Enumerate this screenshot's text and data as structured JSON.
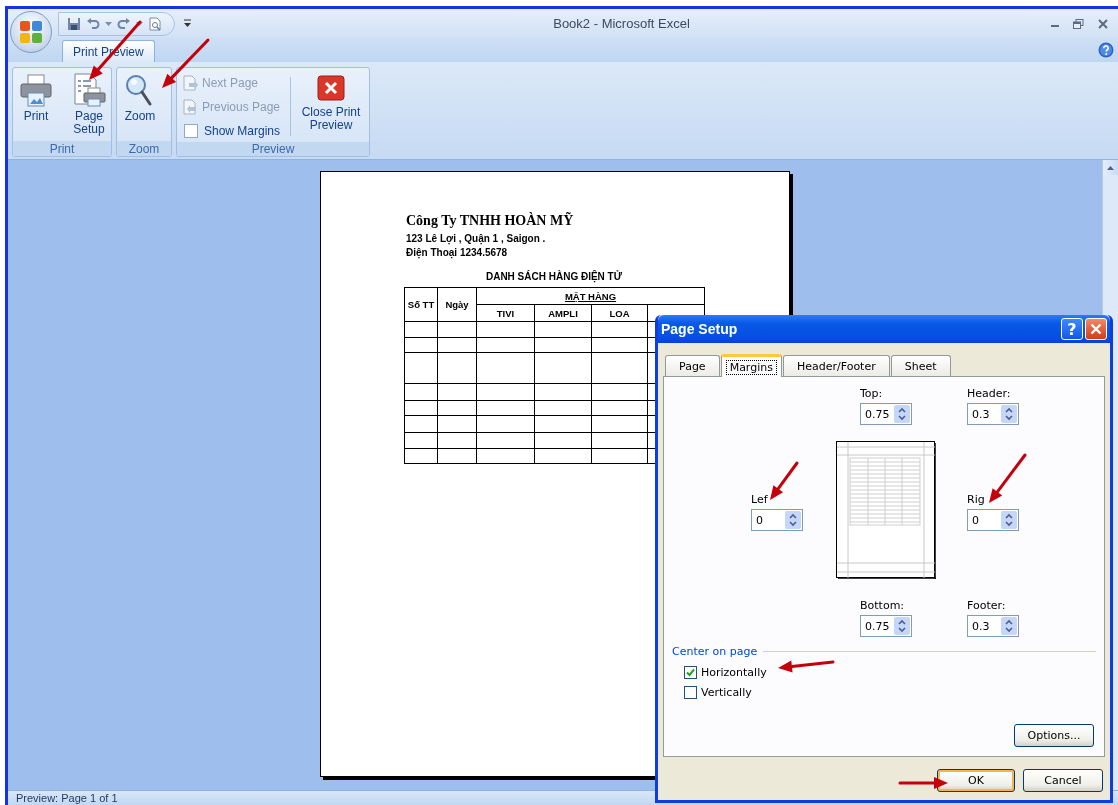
{
  "window": {
    "title": "Book2 - Microsoft Excel"
  },
  "ribbon": {
    "tabs": [
      {
        "label": "Print Preview",
        "selected": true
      }
    ],
    "groups": [
      {
        "label": "Print",
        "items": [
          {
            "kind": "large",
            "label": "Print"
          },
          {
            "kind": "large",
            "label": "Page Setup"
          }
        ]
      },
      {
        "label": "Zoom",
        "items": [
          {
            "kind": "large",
            "label": "Zoom"
          }
        ]
      },
      {
        "label": "Preview",
        "items": [
          {
            "kind": "small",
            "label": "Next Page",
            "disabled": true
          },
          {
            "kind": "small",
            "label": "Previous Page",
            "disabled": true
          },
          {
            "kind": "check",
            "label": "Show Margins",
            "checked": false
          },
          {
            "kind": "large",
            "label": "Close Print Preview"
          }
        ]
      }
    ]
  },
  "preview_page": {
    "company": "Công Ty TNHH HOÀN MỸ",
    "address": "123 Lê Lợi , Quận 1 , Saigon .",
    "phone": "Điện Thoại 1234.5678",
    "table_title": "DANH SÁCH HÀNG ĐIỆN TỬ",
    "columns": [
      "Số TT",
      "Ngày"
    ],
    "group_header": "MẶT HÀNG",
    "subcolumns": [
      "TIVI",
      "AMPLI",
      "LOA"
    ]
  },
  "status_bar": {
    "text": "Preview: Page 1 of 1"
  },
  "dialog": {
    "title": "Page Setup",
    "help_button": "?",
    "tabs": [
      {
        "label": "Page",
        "selected": false
      },
      {
        "label": "Margins",
        "selected": true
      },
      {
        "label": "Header/Footer",
        "selected": false
      },
      {
        "label": "Sheet",
        "selected": false
      }
    ],
    "fields": {
      "top": {
        "label": "Top:",
        "value": "0.75"
      },
      "header": {
        "label": "Header:",
        "value": "0.3"
      },
      "left": {
        "label": "Lef",
        "value": "0"
      },
      "right": {
        "label": "Rig",
        "value": "0"
      },
      "bottom": {
        "label": "Bottom:",
        "value": "0.75"
      },
      "footer": {
        "label": "Footer:",
        "value": "0.3"
      }
    },
    "center_on_page": {
      "label": "Center on page",
      "options": [
        {
          "label": "Horizontally",
          "checked": true
        },
        {
          "label": "Vertically",
          "checked": false
        }
      ]
    },
    "options_button": "Options...",
    "buttons": [
      {
        "label": "OK",
        "selected": true
      },
      {
        "label": "Cancel",
        "selected": false
      }
    ]
  }
}
